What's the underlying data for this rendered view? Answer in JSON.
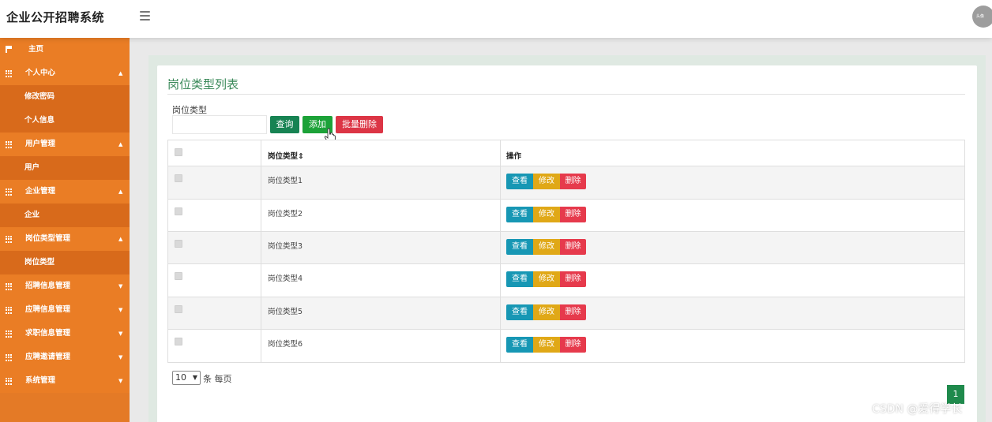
{
  "header": {
    "brand": "企业公开招聘系统",
    "avatar_text": "头像"
  },
  "sidebar": {
    "home": "主页",
    "groups": [
      {
        "label": "个人中心",
        "children": [
          "修改密码",
          "个人信息"
        ]
      },
      {
        "label": "用户管理",
        "children": [
          "用户"
        ]
      },
      {
        "label": "企业管理",
        "children": [
          "企业"
        ]
      },
      {
        "label": "岗位类型管理",
        "children": [
          "岗位类型"
        ]
      },
      {
        "label": "招聘信息管理",
        "children": []
      },
      {
        "label": "应聘信息管理",
        "children": []
      },
      {
        "label": "求职信息管理",
        "children": []
      },
      {
        "label": "应聘邀请管理",
        "children": []
      },
      {
        "label": "系统管理",
        "children": []
      }
    ],
    "caret_up": "▲",
    "caret_down": "▼"
  },
  "page": {
    "title": "岗位类型列表",
    "search_label": "岗位类型",
    "search_value": "",
    "btn_query": "查询",
    "btn_add": "添加",
    "btn_bulk_delete": "批量删除"
  },
  "table": {
    "col_name": "岗位类型⇕",
    "col_action": "操作",
    "rows": [
      "岗位类型1",
      "岗位类型2",
      "岗位类型3",
      "岗位类型4",
      "岗位类型5",
      "岗位类型6"
    ],
    "btn_view": "查看",
    "btn_edit": "修改",
    "btn_delete": "删除"
  },
  "pagination": {
    "page_size": "10",
    "per_page_label": "条 每页",
    "current_page": "1"
  },
  "watermark": "CSDN @爱得学长",
  "colors": {
    "sidebar": "#e47a26",
    "title_green": "#3b8a5a",
    "btn_query": "#178353",
    "btn_add": "#1ca238",
    "btn_delete": "#dc3545"
  }
}
